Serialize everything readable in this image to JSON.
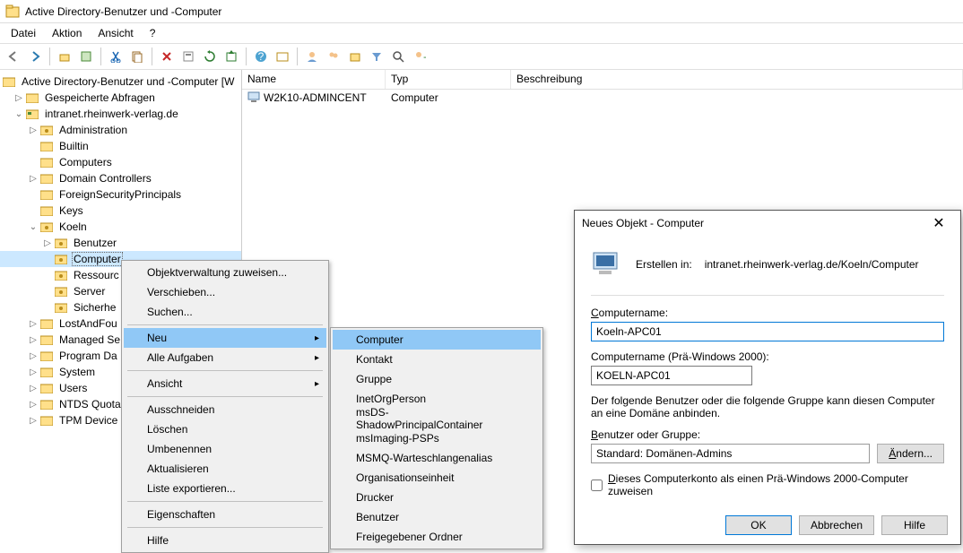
{
  "window": {
    "title": "Active Directory-Benutzer und -Computer"
  },
  "menubar": {
    "items": [
      "Datei",
      "Aktion",
      "Ansicht",
      "?"
    ]
  },
  "tree": {
    "root": "Active Directory-Benutzer und -Computer [W",
    "saved_queries": "Gespeicherte Abfragen",
    "domain": "intranet.rheinwerk-verlag.de",
    "nodes": [
      "Administration",
      "Builtin",
      "Computers",
      "Domain Controllers",
      "ForeignSecurityPrincipals",
      "Keys",
      "Koeln"
    ],
    "koeln_children": [
      "Benutzer",
      "Computer",
      "Ressourc",
      "Server",
      "Sicherhe"
    ],
    "after_koeln": [
      "LostAndFou",
      "Managed Se",
      "Program Da",
      "System",
      "Users",
      "NTDS Quota",
      "TPM Device"
    ]
  },
  "list": {
    "cols": {
      "name": "Name",
      "type": "Typ",
      "desc": "Beschreibung"
    },
    "rows": [
      {
        "name": "W2K10-ADMINCENT",
        "type": "Computer",
        "desc": ""
      }
    ]
  },
  "context1": {
    "items1": [
      "Objektverwaltung zuweisen...",
      "Verschieben...",
      "Suchen..."
    ],
    "neu": "Neu",
    "alle": "Alle Aufgaben",
    "ansicht": "Ansicht",
    "items2": [
      "Ausschneiden",
      "Löschen",
      "Umbenennen",
      "Aktualisieren",
      "Liste exportieren..."
    ],
    "eig": "Eigenschaften",
    "hilfe": "Hilfe"
  },
  "context2": {
    "items": [
      "Computer",
      "Kontakt",
      "Gruppe",
      "InetOrgPerson",
      "msDS-ShadowPrincipalContainer",
      "msImaging-PSPs",
      "MSMQ-Warteschlangenalias",
      "Organisationseinheit",
      "Drucker",
      "Benutzer",
      "Freigegebener Ordner"
    ]
  },
  "dialog": {
    "title": "Neues Objekt - Computer",
    "create_in_label": "Erstellen in:",
    "create_in_path": "intranet.rheinwerk-verlag.de/Koeln/Computer",
    "name_label": "Computername:",
    "name_value": "Koeln-APC01",
    "prewin_label": "Computername (Prä-Windows 2000):",
    "prewin_value": "KOELN-APC01",
    "help_text": "Der folgende Benutzer oder die folgende Gruppe kann diesen Computer an eine Domäne anbinden.",
    "ug_label": "Benutzer oder Gruppe:",
    "ug_value": "Standard: Domänen-Admins",
    "change_btn": "Ändern...",
    "checkbox": "Dieses Computerkonto als einen Prä-Windows 2000-Computer zuweisen",
    "ok": "OK",
    "cancel": "Abbrechen",
    "help": "Hilfe"
  }
}
